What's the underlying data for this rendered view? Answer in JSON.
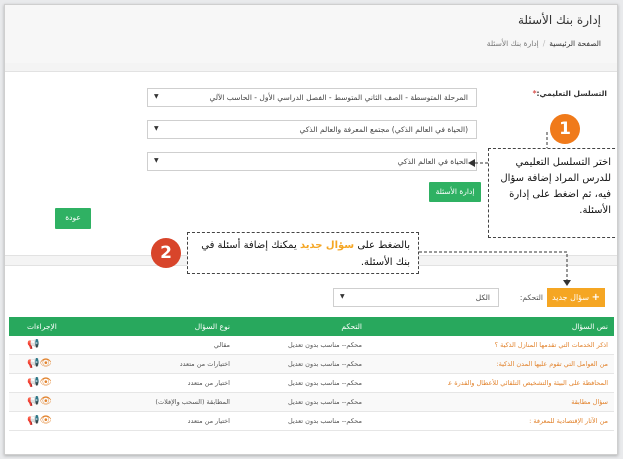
{
  "header": {
    "title": "إدارة بنك الأسئلة",
    "breadcrumb": {
      "home": "الصفحة الرئيسية",
      "separator": "/",
      "current": "إدارة بنك الأسئلة"
    }
  },
  "form": {
    "label": "التسلسل التعليمي:",
    "required_mark": "*",
    "select1": "المرحلة المتوسطة - الصف الثاني المتوسط - الفصل الدراسي الأول - الحاسب الآلي",
    "select2": "(الحياة في العالم الذكي) مجتمع المعرفة والعالم الذكي",
    "select3": "الحياة في العالم الذكي",
    "manage_button": "إدارة الأسئلة",
    "back_button": "عودة"
  },
  "callouts": {
    "one": {
      "number": "1",
      "text": "اختر التسلسل التعليمي للدرس المراد إضافة سؤال فيه، ثم اضغط على إدارة الأسئلة."
    },
    "two": {
      "number": "2",
      "prefix": "بالضغط على",
      "highlight": "سؤال جديد",
      "suffix": "يمكنك إضافة أسئلة في بنك الأسئلة."
    }
  },
  "questions": {
    "new_button": "سؤال جديد",
    "filter_label": "التحكم:",
    "filter_value": "الكل",
    "columns": {
      "question": "نص السؤال",
      "control": "التحكم",
      "type": "نوع السؤال",
      "actions": "الإجراءات"
    },
    "rows": [
      {
        "question": "اذكر الخدمات التي تقدمها المنازل الذكية ؟",
        "control": "محكم-- مناسب بدون تعديل",
        "type": "مقالي"
      },
      {
        "question": "من العوامل التي تقوم عليها المدن الذكية:",
        "control": "محكم-- مناسب بدون تعديل",
        "type": "اختيارات من متعدد"
      },
      {
        "question": "المحافظة على البيئة والتشخيص التلقائي للأعطال والقدرة على إستعادة...",
        "control": "محكم-- مناسب بدون تعديل",
        "type": "اختيار من متعدد"
      },
      {
        "question": "سؤال مطابقة",
        "control": "محكم-- مناسب بدون تعديل",
        "type": "المطابقة (السحب والإفلات)"
      },
      {
        "question": "من الآثار الإقتصادية للمعرفة :",
        "control": "محكم-- مناسب بدون تعديل",
        "type": "اختيار من متعدد"
      }
    ]
  },
  "colors": {
    "accent_green": "#2fb163",
    "accent_orange": "#f5a623",
    "callout_orange": "#f07a1a",
    "callout_red": "#d8452b"
  }
}
